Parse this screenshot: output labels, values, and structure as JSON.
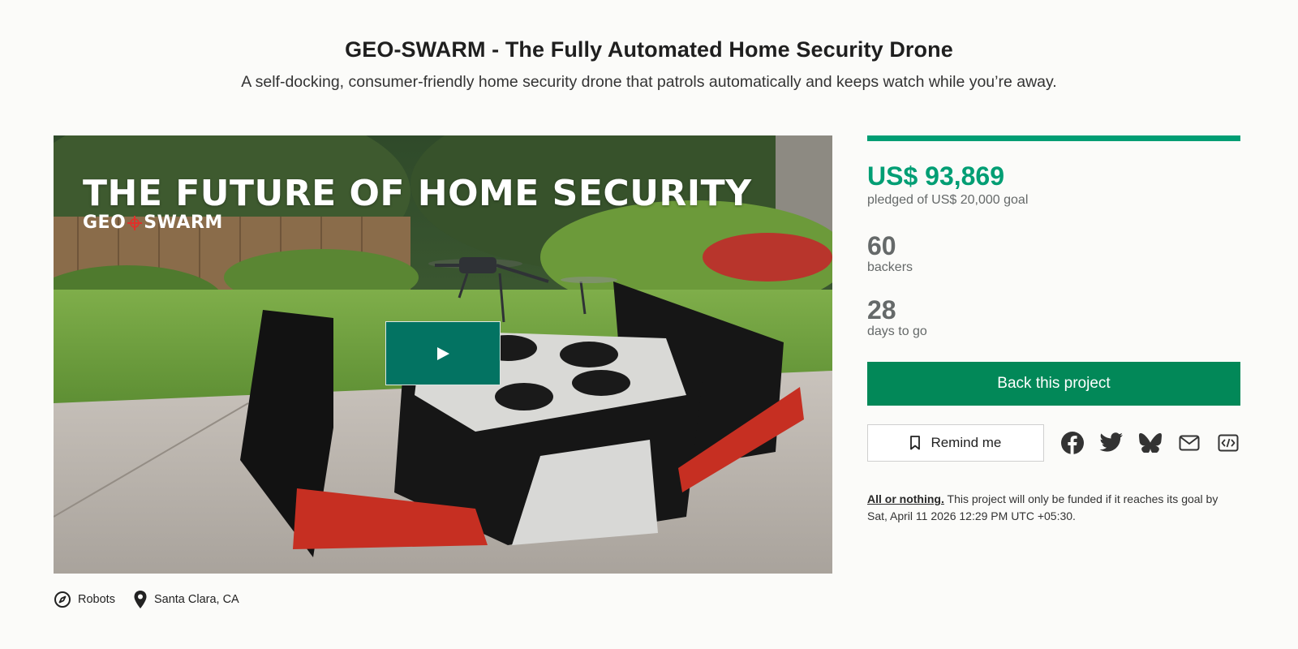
{
  "project": {
    "title": "GEO-SWARM - The Fully Automated Home Security Drone",
    "subtitle": "A self-docking, consumer-friendly home security drone that patrols automatically and keeps watch while you’re away."
  },
  "hero": {
    "headline": "THE FUTURE OF HOME SECURITY",
    "brand_left": "GEO",
    "brand_right": "SWARM",
    "play_icon": "play-icon"
  },
  "meta": {
    "category": "Robots",
    "category_icon": "compass-icon",
    "location": "Santa Clara, CA",
    "location_icon": "location-pin-icon"
  },
  "funding": {
    "pledged": "US$ 93,869",
    "pledged_label": "pledged of US$ 20,000 goal",
    "progress_fraction": 1.0,
    "backers": "60",
    "backers_label": "backers",
    "days": "28",
    "days_label": "days to go"
  },
  "actions": {
    "back_label": "Back this project",
    "remind_label": "Remind me",
    "share_icons": [
      "facebook-icon",
      "twitter-icon",
      "bluesky-icon",
      "email-icon",
      "embed-icon"
    ]
  },
  "fine_print": {
    "strong": "All or nothing.",
    "text": " This project will only be funded if it reaches its goal by Sat, April 11 2026 12:29 PM UTC +05:30."
  },
  "colors": {
    "accent": "#009e74",
    "button": "#028858",
    "play": "#037362",
    "muted": "#656969"
  }
}
